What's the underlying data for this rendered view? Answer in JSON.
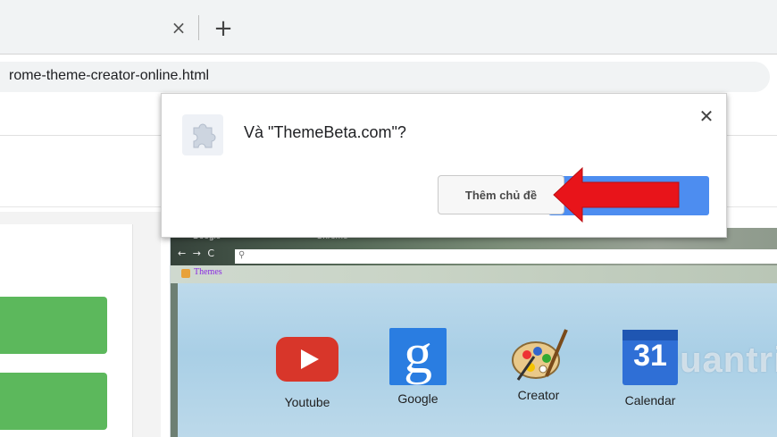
{
  "browser": {
    "tab_close_glyph": "×",
    "new_tab_glyph": "+",
    "url_fragment": "rome-theme-creator-online.html"
  },
  "dialog": {
    "title": "Và \"ThemeBeta.com\"?",
    "close_glyph": "✕",
    "add_theme_label": "Thêm chủ đề",
    "icon": "puzzle-extension-icon"
  },
  "preview": {
    "tabs": [
      "Google",
      "Chrome"
    ],
    "nav_glyphs": "← → C",
    "bookmark_label": "Themes",
    "apps": [
      {
        "label": "Youtube",
        "icon": "youtube-icon"
      },
      {
        "label": "Google",
        "icon": "google-icon",
        "glyph": "g"
      },
      {
        "label": "Creator",
        "icon": "palette-icon"
      },
      {
        "label": "Calendar",
        "icon": "calendar-icon",
        "glyph": "31"
      }
    ],
    "watermark": "Quantrimang"
  },
  "colors": {
    "accent_blue": "#4d8df0",
    "green": "#5cb85c",
    "arrow_red": "#e8141a",
    "youtube_red": "#d8362a"
  }
}
